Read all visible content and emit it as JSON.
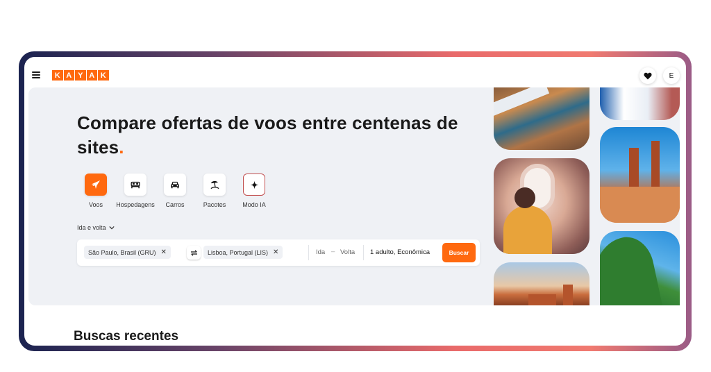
{
  "header": {
    "logo_letters": [
      "K",
      "A",
      "Y",
      "A",
      "K"
    ],
    "avatar_initial": "E"
  },
  "hero": {
    "title": "Compare ofertas de voos entre centenas de sites",
    "title_dot": "."
  },
  "categories": [
    {
      "label": "Voos",
      "icon": "plane-icon",
      "active": true
    },
    {
      "label": "Hospedagens",
      "icon": "bed-icon",
      "active": false
    },
    {
      "label": "Carros",
      "icon": "car-icon",
      "active": false
    },
    {
      "label": "Pacotes",
      "icon": "beach-umbrella-icon",
      "active": false
    },
    {
      "label": "Modo IA",
      "icon": "sparkle-icon",
      "active": false
    }
  ],
  "search": {
    "trip_type": "Ida e volta",
    "origin": "São Paulo, Brasil (GRU)",
    "destination": "Lisboa, Portugal (LIS)",
    "depart_placeholder": "Ida",
    "dash": "–",
    "return_placeholder": "Volta",
    "passengers": "1 adulto, Econômica",
    "submit_label": "Buscar"
  },
  "recent": {
    "title": "Buscas recentes"
  },
  "colors": {
    "brand": "#ff690f",
    "hero_bg": "#eff1f5",
    "text": "#1a1a1a"
  }
}
